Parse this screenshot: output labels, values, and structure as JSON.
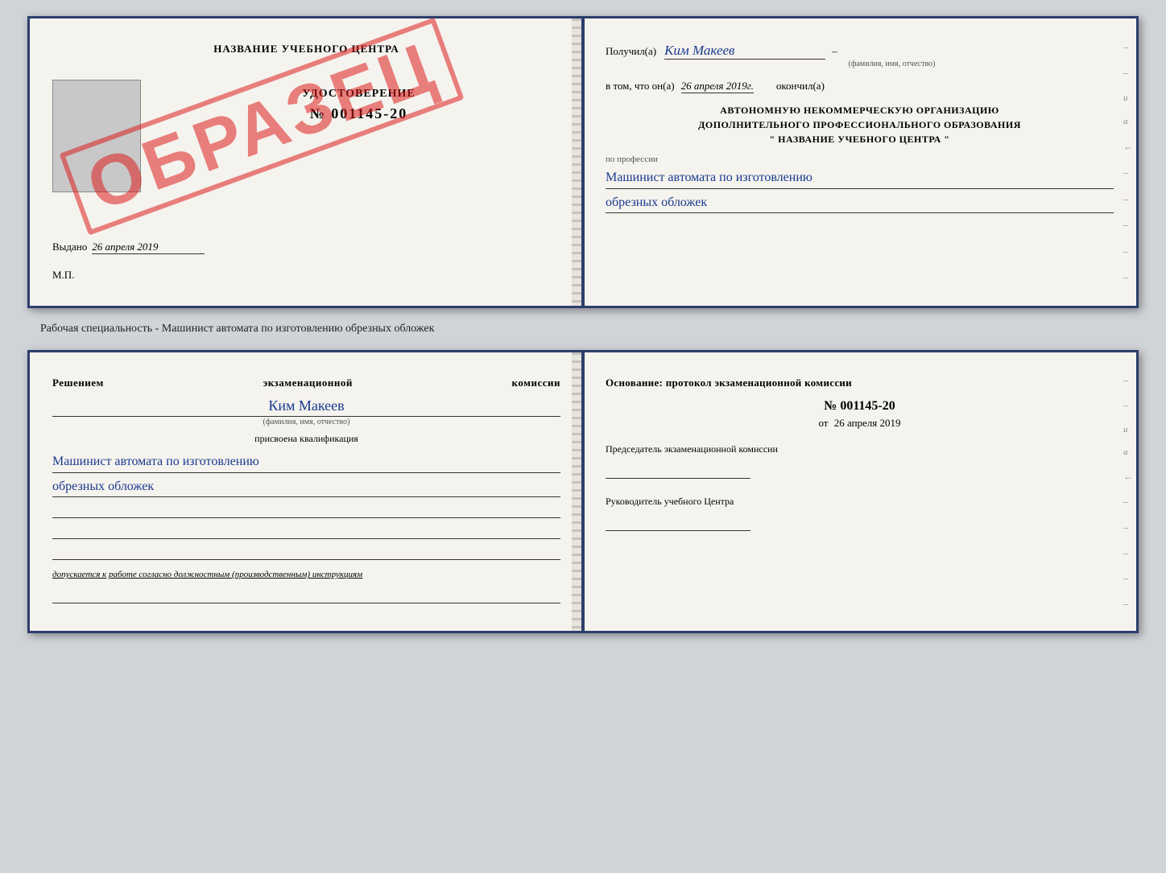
{
  "doc1": {
    "left": {
      "header": "НАЗВАНИЕ УЧЕБНОГО ЦЕНТРА",
      "cert_title": "УДОСТОВЕРЕНИЕ",
      "cert_number": "№ 001145-20",
      "sample_stamp": "ОБРАЗЕЦ",
      "issued_label": "Выдано",
      "issued_date": "26 апреля 2019",
      "mp_label": "М.П."
    },
    "right": {
      "received_label": "Получил(а)",
      "received_name": "Ким Макеев",
      "name_sub": "(фамилия, имя, отчество)",
      "body_text": "в том, что он(а)",
      "date_val": "26 апреля 2019г.",
      "finished_label": "окончил(а)",
      "org_line1": "АВТОНОМНУЮ НЕКОММЕРЧЕСКУЮ ОРГАНИЗАЦИЮ",
      "org_line2": "ДОПОЛНИТЕЛЬНОГО ПРОФЕССИОНАЛЬНОГО ОБРАЗОВАНИЯ",
      "org_line3": "\"  НАЗВАНИЕ УЧЕБНОГО ЦЕНТРА  \"",
      "profession_label": "по профессии",
      "profession_line1": "Машинист автомата по изготовлению",
      "profession_line2": "обрезных обложек"
    }
  },
  "caption": "Рабочая специальность - Машинист автомата по изготовлению обрезных обложек",
  "doc2": {
    "left": {
      "decision_label": "Решением экзаменационной комиссии",
      "person_name": "Ким Макеев",
      "person_sub": "(фамилия, имя, отчество)",
      "assigned_label": "присвоена квалификация",
      "qualification_line1": "Машинист автомата по изготовлению",
      "qualification_line2": "обрезных обложек",
      "blank1": "",
      "blank2": "",
      "blank3": "",
      "admission_text": "допускается к",
      "admission_italic": "работе согласно должностным (производственным) инструкциям",
      "blank4": ""
    },
    "right": {
      "basis_label": "Основание: протокол экзаменационной комиссии",
      "protocol_number": "№  001145-20",
      "protocol_date_prefix": "от",
      "protocol_date": "26 апреля 2019",
      "chairman_label": "Председатель экзаменационной комиссии",
      "director_label": "Руководитель учебного Центра"
    }
  }
}
